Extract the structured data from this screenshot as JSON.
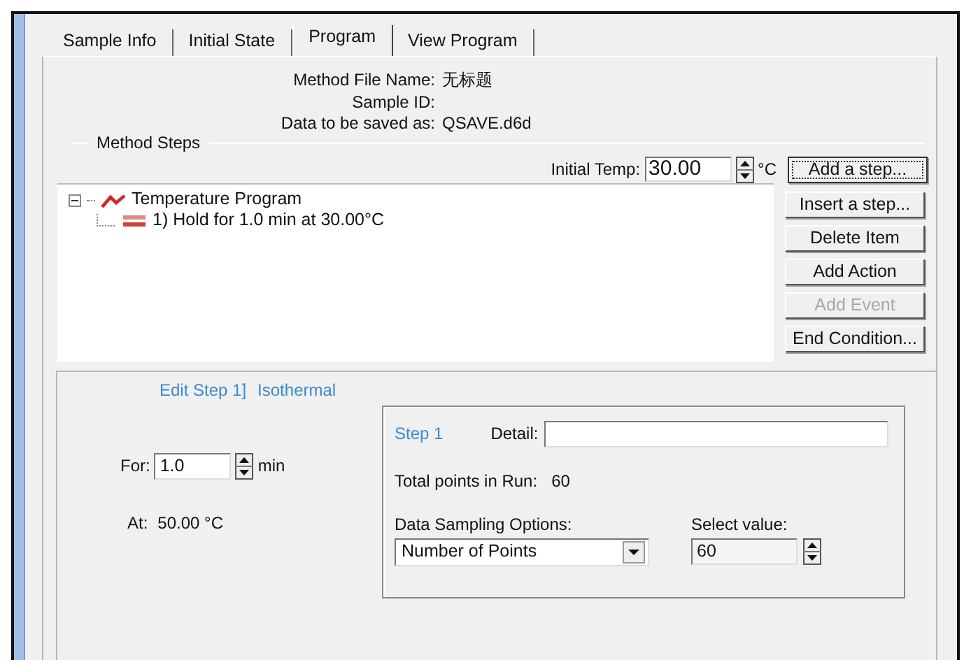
{
  "tabs": [
    {
      "label": "Sample Info",
      "selected": false
    },
    {
      "label": "Initial State",
      "selected": false
    },
    {
      "label": "Program",
      "selected": true
    },
    {
      "label": "View Program",
      "selected": false
    }
  ],
  "header": [
    {
      "label": "Method File Name:",
      "value": "无标题"
    },
    {
      "label": "Sample ID:"
    },
    {
      "label": "Data to be saved as:",
      "value": "QSAVE.d6d"
    }
  ],
  "method_steps": {
    "title": "Method Steps",
    "initial_temp": {
      "label": "Initial Temp:",
      "value": "30.00",
      "unit": "°C"
    },
    "tree": [
      {
        "label": "Temperature Program",
        "expanded": true,
        "children": [
          {
            "label": "1) Hold for 1.0 min at 30.00°C"
          }
        ]
      }
    ],
    "buttons": [
      {
        "label": "Add a step...",
        "disabled": false,
        "focused": true
      },
      {
        "label": "Insert a step...",
        "disabled": false,
        "focused": false
      },
      {
        "label": "Delete Item",
        "disabled": false,
        "focused": false
      },
      {
        "label": "Add Action",
        "disabled": false,
        "focused": false
      },
      {
        "label": "Add Event",
        "disabled": true,
        "focused": false
      },
      {
        "label": "End Condition...",
        "disabled": false,
        "focused": false
      }
    ]
  },
  "edit_step": {
    "title": "Edit Step 1]",
    "type": "Isothermal",
    "for": {
      "label": "For:",
      "value": "1.0",
      "unit": "min"
    },
    "at": {
      "label": "At:",
      "value": "50.00 °C"
    },
    "step": {
      "label": "Step 1",
      "detail_label": "Detail:",
      "total_label": "Total points in Run:",
      "total_value": "60",
      "sampling_label": "Data Sampling Options:",
      "sampling_value": "Number of Points",
      "select_label": "Select value:",
      "select_value": "60"
    }
  }
}
